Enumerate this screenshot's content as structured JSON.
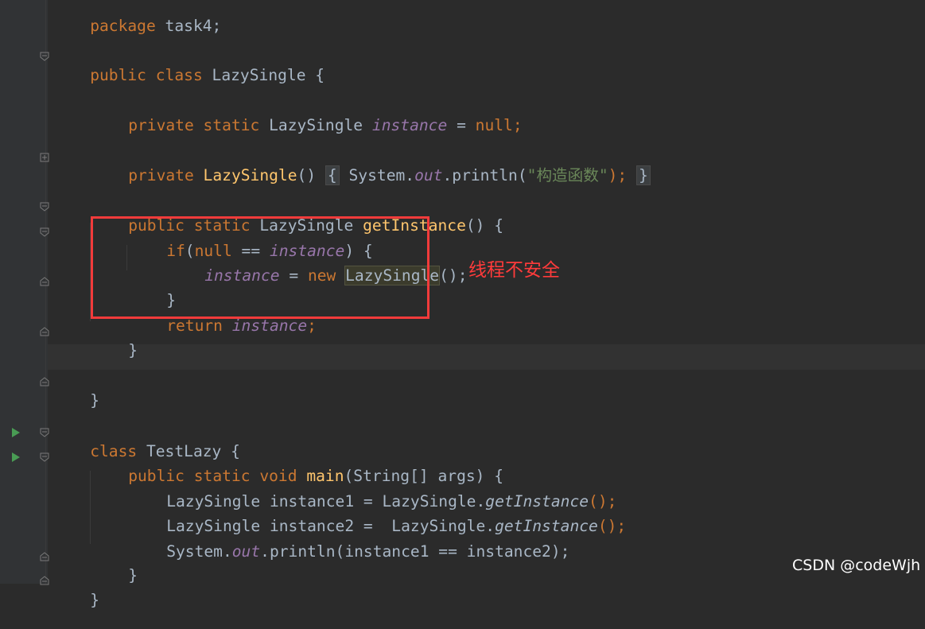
{
  "code": {
    "l1_kw": "package",
    "l1_rest": " task4;",
    "l2_kw": "public class",
    "l2_name": " LazySingle {",
    "l3_kw": "private static",
    "l3_type": " LazySingle ",
    "l3_field": "instance",
    "l3_eq": " = ",
    "l3_null": "null;",
    "l4_kw": "private",
    "l4_ctor": " LazySingle",
    "l4_paren": "()",
    "l4_open": "{",
    "l4_sys": " System.",
    "l4_out": "out",
    "l4_print": ".println(",
    "l4_str": "\"构造函数\"",
    "l4_close": ");",
    "l4_brace": "}",
    "l5_kw": "public static",
    "l5_type": " LazySingle ",
    "l5_fn": "getInstance",
    "l5_rest": "() {",
    "l6_if": "if",
    "l6_open": "(",
    "l6_null": "null",
    "l6_eq": " == ",
    "l6_field": "instance",
    "l6_rest": ") {",
    "l7_field": "instance",
    "l7_eq": " = ",
    "l7_new": "new",
    "l7_cls": "LazySingle",
    "l7_rest": "();",
    "l8_brace": "}",
    "l9_ret": "return",
    "l9_field": " instance",
    "l9_semi": ";",
    "l10_brace": "}",
    "l11_brace": "}",
    "l12_kw": "class",
    "l12_name": " TestLazy {",
    "l13_kw": "public static void",
    "l13_fn": " main",
    "l13_rest": "(String[] args) {",
    "l14_a": "LazySingle instance1 = LazySingle.",
    "l14_m": "getInstance",
    "l14_b": "();",
    "l15_a": "LazySingle instance2 =  LazySingle.",
    "l15_m": "getInstance",
    "l15_b": "();",
    "l16_a": "System.",
    "l16_out": "out",
    "l16_b": ".println(instance1 == instance2);",
    "l17_brace": "}",
    "l18_brace": "}"
  },
  "annotation": {
    "text": "线程不安全"
  },
  "watermark": {
    "text": "CSDN @codeWjh"
  },
  "colors": {
    "background": "#2b2b2b",
    "keyword": "#cc7832",
    "field": "#9876aa",
    "function": "#ffc66d",
    "string": "#6a8759",
    "annotation": "#f23b3b"
  }
}
